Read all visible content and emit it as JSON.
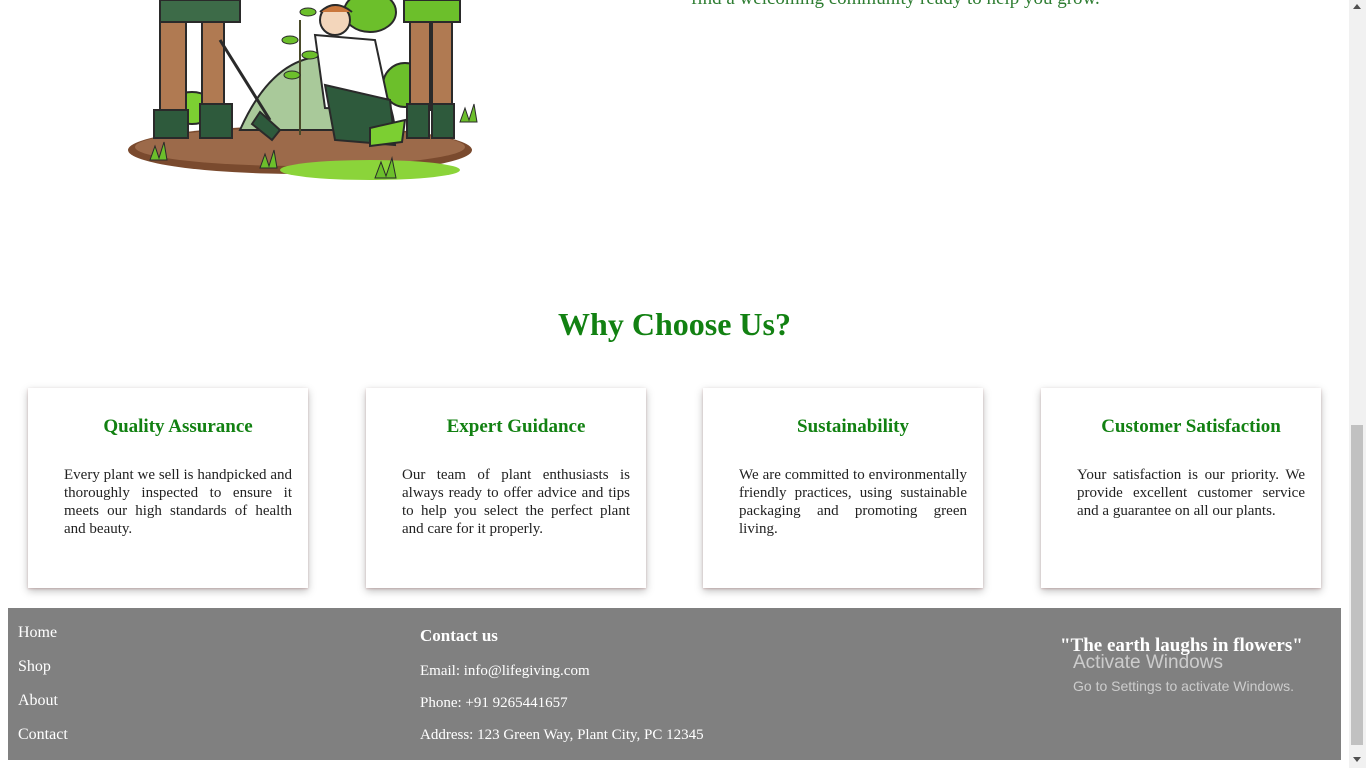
{
  "hero": {
    "text": "find a welcoming community ready to help you grow."
  },
  "why_choose_us": {
    "title": "Why Choose Us?",
    "cards": [
      {
        "title": "Quality Assurance",
        "text": "Every plant we sell is handpicked and thoroughly inspected to ensure it meets our high standards of health and beauty."
      },
      {
        "title": "Expert Guidance",
        "text": "Our team of plant enthusiasts is always ready to offer advice and tips to help you select the perfect plant and care for it properly."
      },
      {
        "title": "Sustainability",
        "text": "We are committed to environmentally friendly practices, using sustainable packaging and promoting green living."
      },
      {
        "title": "Customer Satisfaction",
        "text": "Your satisfaction is our priority. We provide excellent customer service and a guarantee on all our plants."
      }
    ]
  },
  "footer": {
    "nav": [
      "Home",
      "Shop",
      "About",
      "Contact"
    ],
    "contact_title": "Contact us",
    "email": "Email: info@lifegiving.com",
    "phone": "Phone: +91 9265441657",
    "address": "Address: 123 Green Way, Plant City, PC 12345",
    "quote": "\"The earth laughs in flowers\""
  },
  "windows_watermark": {
    "line1": "Activate Windows",
    "line2": "Go to Settings to activate Windows."
  },
  "colors": {
    "accent_green": "#128112",
    "footer_bg": "#808080"
  }
}
